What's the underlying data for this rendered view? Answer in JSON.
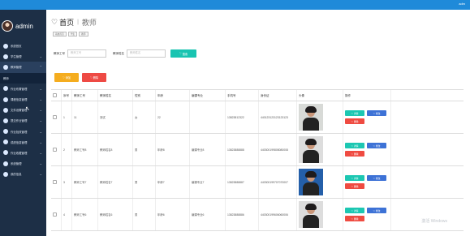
{
  "topbar": {
    "user": "adm"
  },
  "sidebar": {
    "user": "admin",
    "items": [
      {
        "label": "系统首页"
      },
      {
        "label": "学生管理"
      },
      {
        "label": "教师管理"
      },
      {
        "label": "教师"
      },
      {
        "label": "作业布置管理"
      },
      {
        "label": "课程信息管理"
      },
      {
        "label": "文件设置管理"
      },
      {
        "label": "提交作业管理"
      },
      {
        "label": "作业批改管理"
      },
      {
        "label": "成绩信息管理"
      },
      {
        "label": "作业收藏管理"
      },
      {
        "label": "系统管理"
      },
      {
        "label": "我的信息"
      }
    ]
  },
  "page": {
    "title": "首页",
    "subtitle": "教师"
  },
  "breadcrumbs": [
    "系统首页",
    "学生",
    "教师"
  ],
  "filters": {
    "teacher_no_label": "教师工号",
    "teacher_no_placeholder": "教师工号",
    "teacher_name_label": "教师姓名",
    "teacher_name_placeholder": "教师姓名",
    "search_label": "搜索"
  },
  "actions": {
    "add_label": "添加",
    "delete_label": "删除"
  },
  "table": {
    "columns": [
      "",
      "序号",
      "教师工号",
      "教师姓名",
      "性别",
      "年龄",
      "编课专业",
      "手机号",
      "身份证",
      "头像",
      "操作"
    ],
    "rows": [
      {
        "index": "1",
        "teacher_no": "11",
        "name": "测试",
        "gender": "女",
        "age": "22",
        "major": "",
        "phone": "13823812322",
        "id_card": "440123123123123123",
        "photo_style": "dark"
      },
      {
        "index": "2",
        "teacher_no": "教师工号8",
        "name": "教师姓名8",
        "gender": "男",
        "age": "年龄8",
        "major": "编课专业8",
        "phone": "13823888888",
        "id_card": "440300199808080008",
        "photo_style": "light"
      },
      {
        "index": "3",
        "teacher_no": "教师工号7",
        "name": "教师姓名7",
        "gender": "男",
        "age": "年龄7",
        "major": "编课专业7",
        "phone": "13823888887",
        "id_card": "440300199707070007",
        "photo_style": "blue"
      },
      {
        "index": "4",
        "teacher_no": "教师工号6",
        "name": "教师姓名6",
        "gender": "男",
        "age": "年龄6",
        "major": "编课专业6",
        "phone": "13823888886",
        "id_card": "440300199606060006",
        "photo_style": "light"
      }
    ],
    "row_actions": {
      "detail": "详情",
      "edit": "修改",
      "delete": "删除"
    }
  },
  "watermark": "激活 Windows"
}
